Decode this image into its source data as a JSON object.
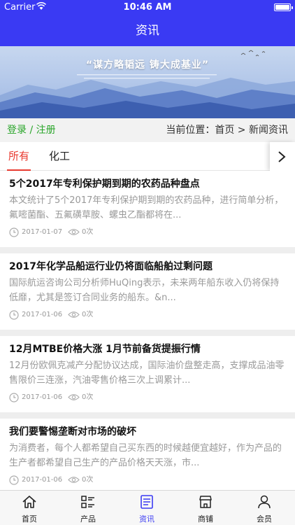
{
  "status_bar": {
    "carrier": "Carrier",
    "time": "10:46 AM"
  },
  "nav": {
    "title": "资讯"
  },
  "banner": {
    "slogan": "“谋方略韬远  铸大成基业”"
  },
  "breadcrumb": {
    "login": "登录",
    "separator": " / ",
    "register": "注册",
    "location": "当前位置：首页 > 新闻资讯"
  },
  "tabs": [
    {
      "label": "所有",
      "active": true
    },
    {
      "label": "化工",
      "active": false
    }
  ],
  "articles": [
    {
      "title": "5个2017年专利保护期到期的农药品种盘点",
      "summary": "本文统计了5个2017年专利保护期到期的农药品种，进行简单分析，氟嘧菌酯、五氟磺草胺、螺虫乙酯都将在...",
      "date": "2017-01-07",
      "views": "0次"
    },
    {
      "title": "2017年化学品船运行业仍将面临船舶过剩问题",
      "summary": "国际航运咨询公司分析师HuQing表示，未来两年船东收入仍将保持低靡，尤其是签订合同业务的船东。&n...",
      "date": "2017-01-06",
      "views": "0次"
    },
    {
      "title": "12月MTBE价格大涨 1月节前备货提振行情",
      "summary": "12月份欧佩克减产分配协议达成，国际油价盘整走高，支撑成品油零售限价三连涨，汽油零售价格三次上调累计...",
      "date": "2017-01-06",
      "views": "0次"
    },
    {
      "title": "我们要警惕垄断对市场的破坏",
      "summary": "为消费者，每个人都希望自己买东西的时候越便宜越好，作为产品的生产者都希望自己生产的产品价格天天涨，市...",
      "date": "2017-01-06",
      "views": "0次"
    }
  ],
  "tabbar": [
    {
      "label": "首页",
      "icon": "home-icon"
    },
    {
      "label": "产品",
      "icon": "list-icon"
    },
    {
      "label": "资讯",
      "icon": "news-icon",
      "active": true
    },
    {
      "label": "商铺",
      "icon": "shop-icon"
    },
    {
      "label": "会员",
      "icon": "user-icon"
    }
  ],
  "colors": {
    "primary": "#3a3af3",
    "accent_red": "#e83a2f",
    "login_green": "#2aa52a"
  }
}
